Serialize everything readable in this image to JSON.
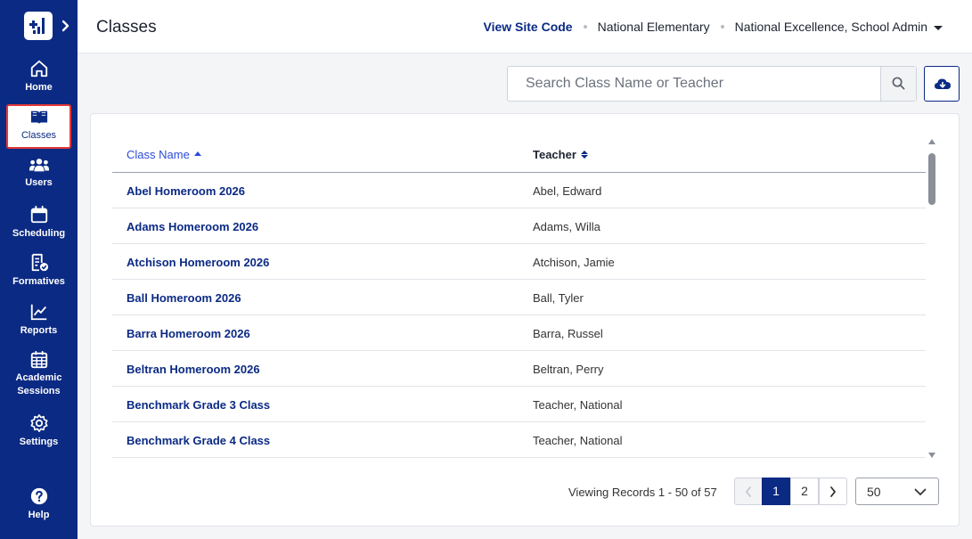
{
  "sidebar": {
    "items": [
      {
        "label": "Home",
        "icon": "home-icon"
      },
      {
        "label": "Classes",
        "icon": "book-icon"
      },
      {
        "label": "Users",
        "icon": "users-icon"
      },
      {
        "label": "Scheduling",
        "icon": "calendar-icon"
      },
      {
        "label": "Formatives",
        "icon": "formatives-icon"
      },
      {
        "label": "Reports",
        "icon": "chart-line-icon"
      },
      {
        "label": "Academic Sessions",
        "label_line1": "Academic",
        "label_line2": "Sessions",
        "icon": "calendar-grid-icon"
      },
      {
        "label": "Settings",
        "icon": "gear-icon"
      },
      {
        "label": "Help",
        "icon": "help-icon"
      }
    ],
    "active": "Classes"
  },
  "header": {
    "title": "Classes",
    "view_site_code": "View Site Code",
    "school": "National Elementary",
    "user": "National Excellence, School Admin"
  },
  "search": {
    "placeholder": "Search Class Name or Teacher"
  },
  "table": {
    "columns": [
      "Class Name",
      "Teacher"
    ],
    "rows": [
      {
        "class_name": "Abel Homeroom 2026",
        "teacher": "Abel, Edward"
      },
      {
        "class_name": "Adams Homeroom 2026",
        "teacher": "Adams, Willa"
      },
      {
        "class_name": "Atchison Homeroom 2026",
        "teacher": "Atchison, Jamie"
      },
      {
        "class_name": "Ball Homeroom 2026",
        "teacher": "Ball, Tyler"
      },
      {
        "class_name": "Barra Homeroom 2026",
        "teacher": "Barra, Russel"
      },
      {
        "class_name": "Beltran Homeroom 2026",
        "teacher": "Beltran, Perry"
      },
      {
        "class_name": "Benchmark Grade 3 Class",
        "teacher": "Teacher, National"
      },
      {
        "class_name": "Benchmark Grade 4 Class",
        "teacher": "Teacher, National"
      }
    ]
  },
  "pagination": {
    "records_text": "Viewing Records 1 - 50 of 57",
    "pages": [
      "1",
      "2"
    ],
    "current_page": "1",
    "per_page": "50"
  },
  "colors": {
    "brand": "#0b2a84",
    "link": "#2d4bd9",
    "active_outline": "#e53935"
  }
}
